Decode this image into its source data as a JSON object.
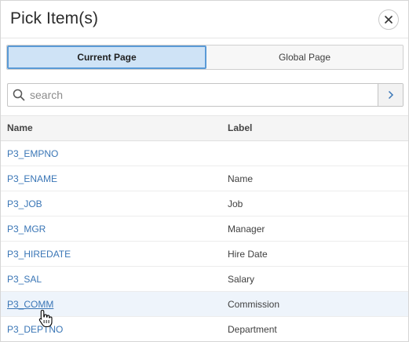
{
  "dialog": {
    "title": "Pick Item(s)"
  },
  "tabs": [
    {
      "label": "Current Page",
      "active": true
    },
    {
      "label": "Global Page",
      "active": false
    }
  ],
  "search": {
    "placeholder": "search",
    "value": ""
  },
  "table": {
    "headers": {
      "name": "Name",
      "label": "Label"
    },
    "rows": [
      {
        "name": "P3_EMPNO",
        "label": ""
      },
      {
        "name": "P3_ENAME",
        "label": "Name"
      },
      {
        "name": "P3_JOB",
        "label": "Job"
      },
      {
        "name": "P3_MGR",
        "label": "Manager"
      },
      {
        "name": "P3_HIREDATE",
        "label": "Hire Date"
      },
      {
        "name": "P3_SAL",
        "label": "Salary"
      },
      {
        "name": "P3_COMM",
        "label": "Commission"
      },
      {
        "name": "P3_DEPTNO",
        "label": "Department"
      }
    ]
  },
  "colors": {
    "accent": "#5a9ad6",
    "link": "#3a76b6",
    "active_tab_bg": "#cfe3f6",
    "hover_row_bg": "#eef4fb"
  },
  "icons": {
    "close": "close-icon",
    "search": "search-icon",
    "go": "chevron-right-icon",
    "cursor": "hand-pointer-icon"
  }
}
